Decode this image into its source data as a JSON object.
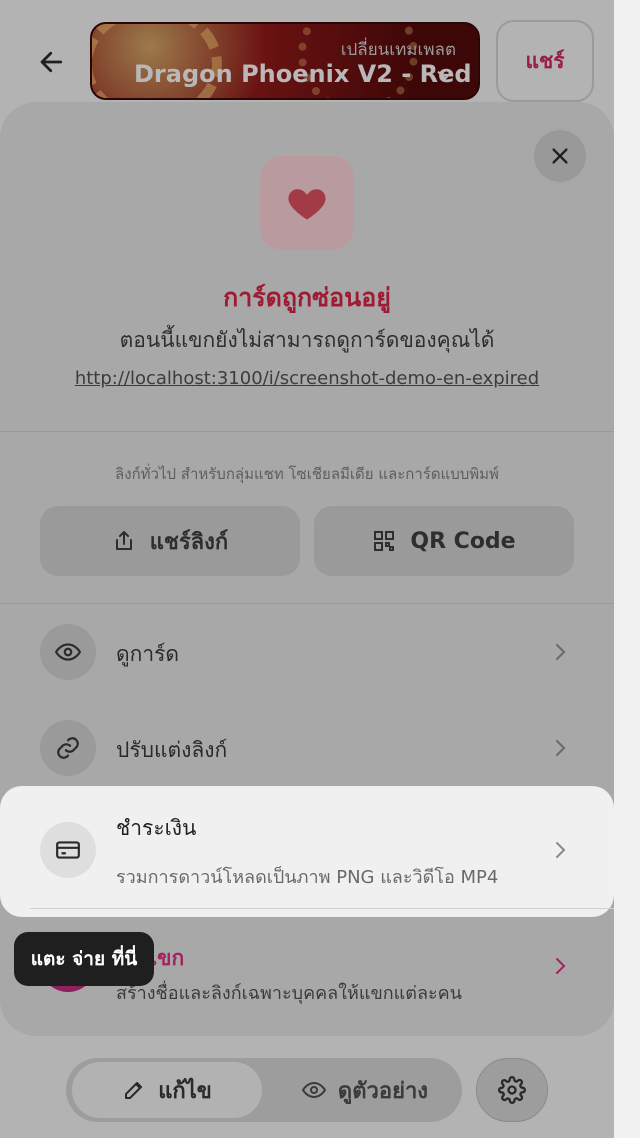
{
  "header": {
    "template_caption": "เปลี่ยนเทมเพลต",
    "template_name": "Dragon Phoenix V2 - Red",
    "share_label": "แชร์"
  },
  "sheet": {
    "status_title": "การ์ดถูกซ่อนอยู่",
    "status_subtitle": "ตอนนี้แขกยังไม่สามารถดูการ์ดของคุณได้",
    "card_url": "http://localhost:3100/i/screenshot-demo-en-expired",
    "share_caption": "ลิงก์ทั่วไป สำหรับกลุ่มแชท โซเชียลมีเดีย และการ์ดแบบพิมพ์",
    "share_link_label": "แชร์ลิงก์",
    "qr_code_label": "QR Code",
    "rows": [
      {
        "label": "ดูการ์ด"
      },
      {
        "label": "ปรับแต่งลิงก์"
      }
    ],
    "payment": {
      "title": "ชำระเงิน",
      "description": "รวมการดาวน์โหลดเป็นภาพ PNG และวิดีโอ MP4"
    },
    "guest": {
      "label_partial": "เขก",
      "description_partial": "สร้างชื่อและลิงก์เฉพาะบุคคลให้แขกแต่ละคน"
    }
  },
  "tooltip": {
    "text": "แตะ จ่าย ที่นี่"
  },
  "toolbar": {
    "edit_label": "แก้ไข",
    "preview_label": "ดูตัวอย่าง"
  },
  "icons": {
    "back": "arrow-left-icon",
    "close": "close-icon",
    "heart": "heart-icon",
    "share": "share-icon",
    "qr": "qr-code-icon",
    "eye": "eye-icon",
    "link": "link-icon",
    "card": "credit-card-icon",
    "chevron": "chevron-right-icon",
    "edit": "pencil-icon",
    "gear": "gear-icon"
  },
  "colors": {
    "accent": "#c2185b",
    "status_red": "#d32f2f",
    "tooltip_bg": "#1f1f1f"
  }
}
